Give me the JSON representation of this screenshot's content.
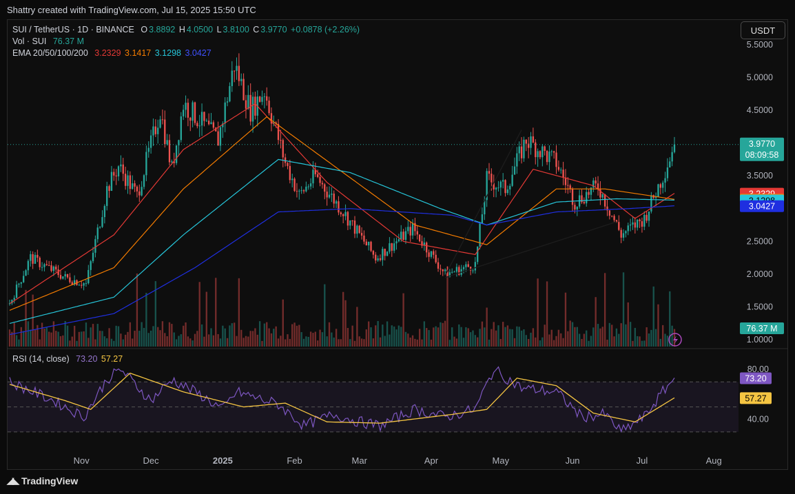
{
  "caption": "Shattry created with TradingView.com, Jul 15, 2025 15:50 UTC",
  "currency_button": "USDT",
  "footer": {
    "logo": "TradingView"
  },
  "legend": {
    "symbol": "SUI / TetherUS · 1D · BINANCE",
    "o_label": "O",
    "o_value": "3.8892",
    "h_label": "H",
    "h_value": "4.0500",
    "l_label": "L",
    "l_value": "3.8100",
    "c_label": "C",
    "c_value": "3.9770",
    "change": "+0.0878 (+2.26%)",
    "vol_label": "Vol · SUI",
    "vol_value": "76.37 M",
    "ema_label": "EMA 20/50/100/200",
    "ema20": "3.2329",
    "ema50": "3.1417",
    "ema100": "3.1298",
    "ema200": "3.0427",
    "rsi_label": "RSI (14, close)",
    "rsi_value": "73.20",
    "rsi_ma_value": "57.27"
  },
  "colors": {
    "up": "#26a69a",
    "down": "#ef5350",
    "ema20": "#e53935",
    "ema50": "#f57c00",
    "ema100": "#26c6da",
    "ema200": "#1f2fe0",
    "rsi": "#7e57c2",
    "rsi_ma": "#f5c542",
    "price_tag": "#26a69a",
    "volume_tag": "#26a69a"
  },
  "chart_data": {
    "type": "candlestick",
    "symbol": "SUI / TetherUS",
    "interval": "1D",
    "exchange": "BINANCE",
    "price_axis": {
      "ticks": [
        "5.5000",
        "5.0000",
        "4.5000",
        "4.0000",
        "3.5000",
        "3.0000",
        "2.5000",
        "2.0000",
        "1.5000",
        "1.0000"
      ],
      "range": [
        0.95,
        5.55
      ]
    },
    "x_ticks": [
      "Nov",
      "Dec",
      "2025",
      "Feb",
      "Mar",
      "Apr",
      "May",
      "Jun",
      "Jul",
      "Aug"
    ],
    "last_price": {
      "value": "3.9770",
      "countdown": "08:09:58",
      "series_value": 3.977
    },
    "volume_tag": "76.37 M",
    "price_keypoints": [
      {
        "date": "2024-10-01",
        "close": 1.55
      },
      {
        "date": "2024-10-10",
        "close": 2.25
      },
      {
        "date": "2024-10-25",
        "close": 1.95
      },
      {
        "date": "2024-11-03",
        "close": 1.85
      },
      {
        "date": "2024-11-12",
        "close": 3.3
      },
      {
        "date": "2024-11-17",
        "close": 3.65
      },
      {
        "date": "2024-11-25",
        "close": 3.2
      },
      {
        "date": "2024-12-05",
        "close": 4.5
      },
      {
        "date": "2024-12-10",
        "close": 3.6
      },
      {
        "date": "2024-12-15",
        "close": 4.6
      },
      {
        "date": "2024-12-30",
        "close": 4.05
      },
      {
        "date": "2025-01-06",
        "close": 5.2
      },
      {
        "date": "2025-01-13",
        "close": 4.5
      },
      {
        "date": "2025-01-19",
        "close": 4.8
      },
      {
        "date": "2025-01-28",
        "close": 3.7
      },
      {
        "date": "2025-02-03",
        "close": 3.2
      },
      {
        "date": "2025-02-10",
        "close": 3.5
      },
      {
        "date": "2025-02-22",
        "close": 2.95
      },
      {
        "date": "2025-03-08",
        "close": 2.25
      },
      {
        "date": "2025-03-24",
        "close": 2.7
      },
      {
        "date": "2025-04-07",
        "close": 2.0
      },
      {
        "date": "2025-04-20",
        "close": 2.15
      },
      {
        "date": "2025-04-25",
        "close": 3.45
      },
      {
        "date": "2025-05-03",
        "close": 3.3
      },
      {
        "date": "2025-05-12",
        "close": 4.05
      },
      {
        "date": "2025-05-25",
        "close": 3.7
      },
      {
        "date": "2025-06-02",
        "close": 3.1
      },
      {
        "date": "2025-06-12",
        "close": 3.35
      },
      {
        "date": "2025-06-22",
        "close": 2.6
      },
      {
        "date": "2025-07-02",
        "close": 2.85
      },
      {
        "date": "2025-07-10",
        "close": 3.5
      },
      {
        "date": "2025-07-15",
        "close": 3.977
      }
    ],
    "ema_keypoints": {
      "EMA 20": [
        {
          "date": "2024-10-01",
          "value": 1.55
        },
        {
          "date": "2024-11-15",
          "value": 2.6
        },
        {
          "date": "2024-12-15",
          "value": 3.9
        },
        {
          "date": "2025-01-15",
          "value": 4.6
        },
        {
          "date": "2025-02-15",
          "value": 3.4
        },
        {
          "date": "2025-03-20",
          "value": 2.5
        },
        {
          "date": "2025-04-20",
          "value": 2.3
        },
        {
          "date": "2025-05-15",
          "value": 3.6
        },
        {
          "date": "2025-06-10",
          "value": 3.35
        },
        {
          "date": "2025-06-28",
          "value": 2.85
        },
        {
          "date": "2025-07-15",
          "value": 3.2329
        }
      ],
      "EMA 50": [
        {
          "date": "2024-10-01",
          "value": 1.45
        },
        {
          "date": "2024-11-15",
          "value": 2.1
        },
        {
          "date": "2024-12-15",
          "value": 3.3
        },
        {
          "date": "2025-01-20",
          "value": 4.4
        },
        {
          "date": "2025-02-20",
          "value": 3.6
        },
        {
          "date": "2025-03-25",
          "value": 2.75
        },
        {
          "date": "2025-04-25",
          "value": 2.45
        },
        {
          "date": "2025-05-25",
          "value": 3.3
        },
        {
          "date": "2025-06-15",
          "value": 3.3
        },
        {
          "date": "2025-07-15",
          "value": 3.1417
        }
      ],
      "EMA 100": [
        {
          "date": "2024-10-01",
          "value": 1.25
        },
        {
          "date": "2024-11-15",
          "value": 1.65
        },
        {
          "date": "2024-12-15",
          "value": 2.6
        },
        {
          "date": "2025-01-25",
          "value": 3.75
        },
        {
          "date": "2025-02-25",
          "value": 3.55
        },
        {
          "date": "2025-04-05",
          "value": 3.0
        },
        {
          "date": "2025-04-25",
          "value": 2.75
        },
        {
          "date": "2025-05-25",
          "value": 3.1
        },
        {
          "date": "2025-06-20",
          "value": 3.15
        },
        {
          "date": "2025-07-15",
          "value": 3.1298
        }
      ],
      "EMA 200": [
        {
          "date": "2024-10-01",
          "value": 1.08
        },
        {
          "date": "2024-11-15",
          "value": 1.4
        },
        {
          "date": "2024-12-20",
          "value": 2.1
        },
        {
          "date": "2025-01-25",
          "value": 2.95
        },
        {
          "date": "2025-02-25",
          "value": 3.0
        },
        {
          "date": "2025-04-10",
          "value": 2.9
        },
        {
          "date": "2025-04-25",
          "value": 2.75
        },
        {
          "date": "2025-05-25",
          "value": 2.95
        },
        {
          "date": "2025-06-25",
          "value": 3.0
        },
        {
          "date": "2025-07-15",
          "value": 3.0427
        }
      ]
    },
    "trendlines": [
      [
        {
          "date": "2025-04-07",
          "value": 1.98
        },
        {
          "date": "2025-05-10",
          "value": 4.2
        }
      ],
      [
        {
          "date": "2025-04-07",
          "value": 1.95
        },
        {
          "date": "2025-06-20",
          "value": 2.8
        }
      ]
    ],
    "rsi": {
      "axis_ticks": [
        "80.00",
        "40.00"
      ],
      "range": [
        20,
        90
      ],
      "bands": [
        30,
        50,
        70
      ],
      "last": 73.2,
      "last_ma": 57.27,
      "rsi_keypoints": [
        {
          "date": "2024-10-01",
          "value": 70
        },
        {
          "date": "2024-10-20",
          "value": 55
        },
        {
          "date": "2024-11-02",
          "value": 42
        },
        {
          "date": "2024-11-12",
          "value": 72
        },
        {
          "date": "2024-11-18",
          "value": 80
        },
        {
          "date": "2024-12-01",
          "value": 55
        },
        {
          "date": "2024-12-10",
          "value": 72
        },
        {
          "date": "2024-12-22",
          "value": 60
        },
        {
          "date": "2025-01-01",
          "value": 48
        },
        {
          "date": "2025-01-07",
          "value": 62
        },
        {
          "date": "2025-01-25",
          "value": 52
        },
        {
          "date": "2025-02-05",
          "value": 35
        },
        {
          "date": "2025-02-18",
          "value": 44
        },
        {
          "date": "2025-03-01",
          "value": 38
        },
        {
          "date": "2025-03-10",
          "value": 35
        },
        {
          "date": "2025-03-25",
          "value": 48
        },
        {
          "date": "2025-04-07",
          "value": 42
        },
        {
          "date": "2025-04-20",
          "value": 48
        },
        {
          "date": "2025-04-28",
          "value": 80
        },
        {
          "date": "2025-05-10",
          "value": 65
        },
        {
          "date": "2025-05-25",
          "value": 62
        },
        {
          "date": "2025-06-05",
          "value": 42
        },
        {
          "date": "2025-06-15",
          "value": 44
        },
        {
          "date": "2025-06-22",
          "value": 30
        },
        {
          "date": "2025-07-02",
          "value": 42
        },
        {
          "date": "2025-07-10",
          "value": 62
        },
        {
          "date": "2025-07-15",
          "value": 73.2
        }
      ],
      "ma_keypoints": [
        {
          "date": "2024-10-01",
          "value": 68
        },
        {
          "date": "2024-10-25",
          "value": 55
        },
        {
          "date": "2024-11-05",
          "value": 48
        },
        {
          "date": "2024-11-22",
          "value": 77
        },
        {
          "date": "2024-12-15",
          "value": 62
        },
        {
          "date": "2025-01-10",
          "value": 50
        },
        {
          "date": "2025-01-28",
          "value": 53
        },
        {
          "date": "2025-02-15",
          "value": 38
        },
        {
          "date": "2025-03-10",
          "value": 37
        },
        {
          "date": "2025-04-10",
          "value": 44
        },
        {
          "date": "2025-04-25",
          "value": 48
        },
        {
          "date": "2025-05-08",
          "value": 73
        },
        {
          "date": "2025-05-25",
          "value": 67
        },
        {
          "date": "2025-06-10",
          "value": 45
        },
        {
          "date": "2025-06-28",
          "value": 38
        },
        {
          "date": "2025-07-15",
          "value": 57.27
        }
      ]
    }
  }
}
